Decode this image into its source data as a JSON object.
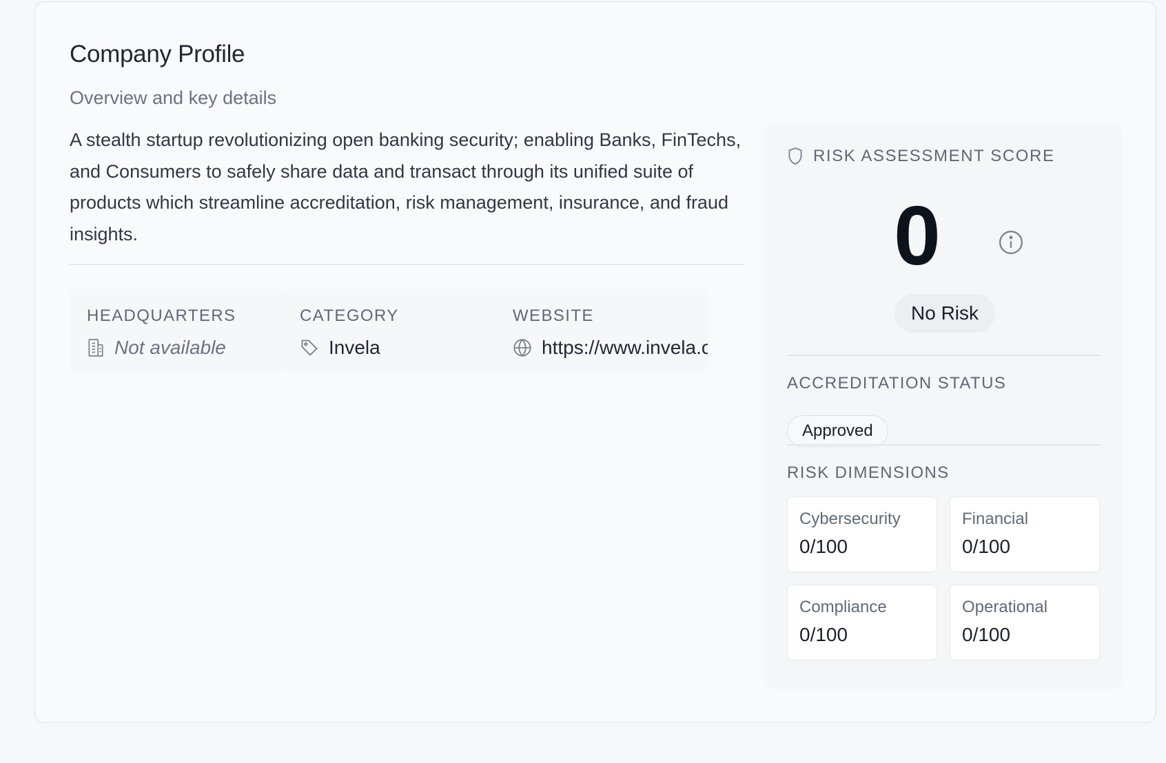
{
  "profile": {
    "title": "Company Profile",
    "subtitle": "Overview and key details",
    "description": "A stealth startup revolutionizing open banking security; enabling Banks, FinTechs, and Consumers to safely share data and transact through its unified suite of products which streamline accreditation, risk management, insurance, and fraud insights."
  },
  "info": {
    "headquarters": {
      "label": "HEADQUARTERS",
      "value": "Not available",
      "icon": "building-icon"
    },
    "category": {
      "label": "CATEGORY",
      "value": "Invela",
      "icon": "tag-icon"
    },
    "website": {
      "label": "WEBSITE",
      "value": "https://www.invela.com",
      "icon": "globe-icon"
    }
  },
  "risk": {
    "header": "RISK ASSESSMENT SCORE",
    "score": "0",
    "level": "No Risk",
    "accreditation_label": "ACCREDITATION STATUS",
    "accreditation_status": "Approved",
    "dimensions_label": "RISK DIMENSIONS",
    "dimensions": [
      {
        "name": "Cybersecurity",
        "score": "0/100"
      },
      {
        "name": "Financial",
        "score": "0/100"
      },
      {
        "name": "Compliance",
        "score": "0/100"
      },
      {
        "name": "Operational",
        "score": "0/100"
      }
    ]
  },
  "colors": {
    "card_bg": "#f9fafc",
    "panel_bg": "#f4f6f8",
    "text_primary": "#1f2732",
    "text_muted": "#6b7380"
  }
}
